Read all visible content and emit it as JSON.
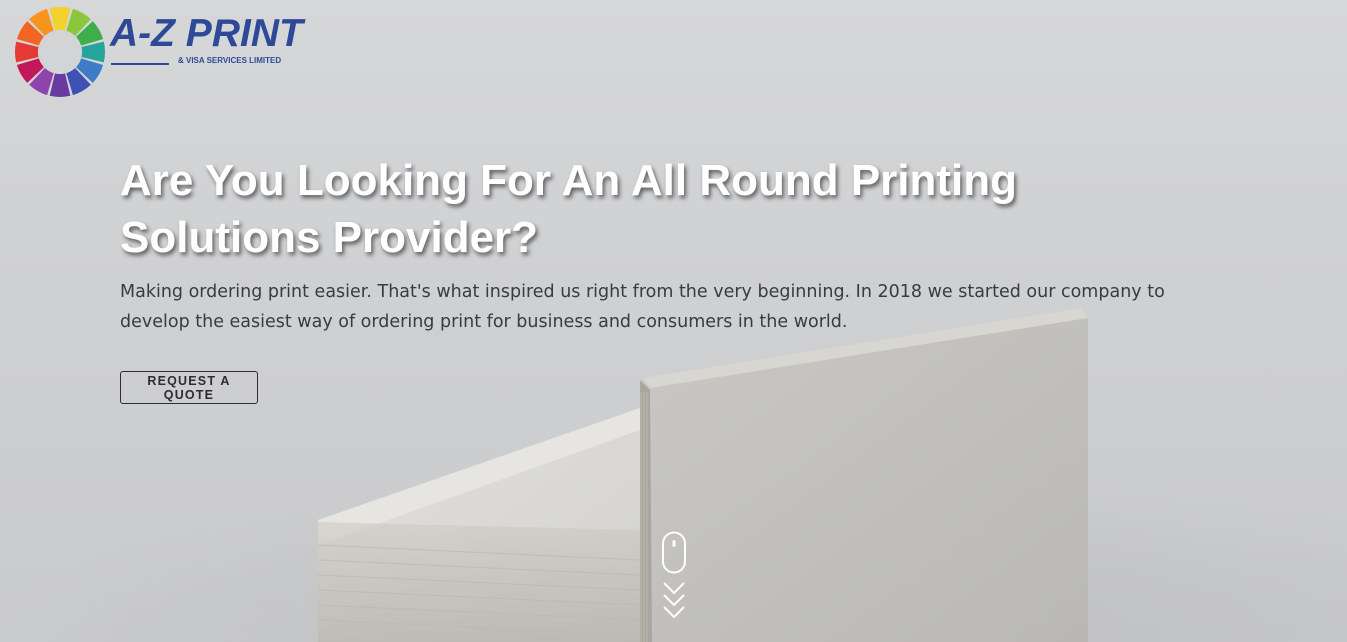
{
  "brand": {
    "name": "A-Z PRINT",
    "subtitle": "& VISA SERVICES LIMITED",
    "wheel_colors": [
      "#f3d22e",
      "#8cc63f",
      "#3dae49",
      "#26a69a",
      "#3e7cc8",
      "#3f51b5",
      "#6a3aa0",
      "#8e44ad",
      "#c2185b",
      "#e53935",
      "#f26522",
      "#f7941d"
    ],
    "text_color": "#2e4a97"
  },
  "hero": {
    "headline": "Are You Looking For An All Round Printing Solutions Provider?",
    "description": "Making ordering print easier. That's what inspired us right from the very beginning. In 2018 we started our company to develop the easiest way of ordering print for business and consumers in the world.",
    "cta_label": "REQUEST A QUOTE"
  },
  "icons": {
    "logo_wheel": "color-wheel-icon",
    "scroll": "scroll-mouse-icon",
    "chevrons": "chevron-down-icon"
  }
}
